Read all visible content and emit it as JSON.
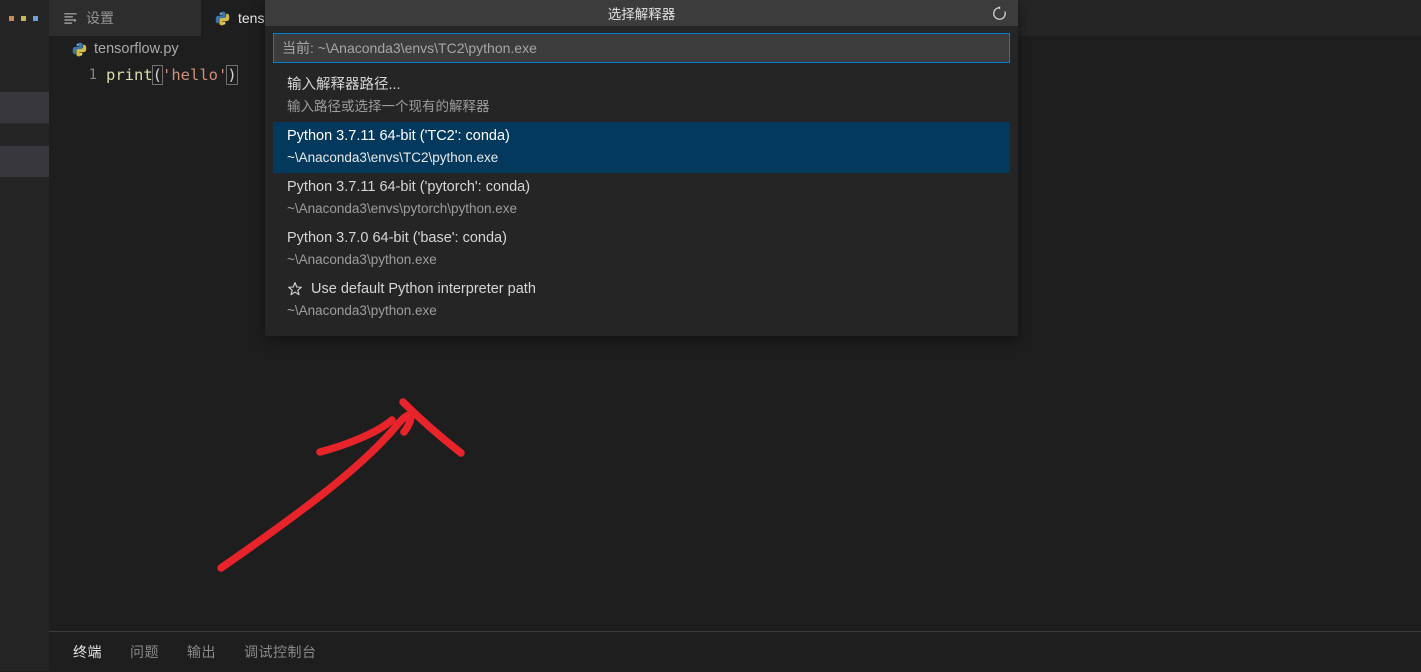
{
  "colors": {
    "editor_bg": "#1e1e1e",
    "chrome_bg": "#252526",
    "titlebar_bg": "#3c3c3c",
    "accent_blue": "#007fd4",
    "selection_blue": "#04395e",
    "annotation_red": "#e8232a"
  },
  "activity_strip": {
    "more_actions_icon": "more-actions-icon"
  },
  "tabs": [
    {
      "label": "设置",
      "icon": "settings-lines-icon",
      "active": false
    },
    {
      "label": "tens",
      "icon": "python-file-icon",
      "active": true
    }
  ],
  "editor": {
    "breadcrumb": {
      "icon": "python-file-icon",
      "label": "tensorflow.py"
    },
    "code": {
      "line_number": "1",
      "tokens": {
        "fn": "print",
        "open_paren": "(",
        "string": "'hello'",
        "close_paren": ")"
      }
    }
  },
  "quickpick": {
    "title": "选择解释器",
    "refresh_icon": "refresh-icon",
    "input": {
      "value": "",
      "placeholder": "当前: ~\\Anaconda3\\envs\\TC2\\python.exe"
    },
    "items": [
      {
        "label": "输入解释器路径...",
        "description": "输入路径或选择一个现有的解释器",
        "icon": "",
        "selected": false
      },
      {
        "label": "Python 3.7.11 64-bit ('TC2': conda)",
        "description": "~\\Anaconda3\\envs\\TC2\\python.exe",
        "icon": "",
        "selected": true
      },
      {
        "label": "Python 3.7.11 64-bit ('pytorch': conda)",
        "description": "~\\Anaconda3\\envs\\pytorch\\python.exe",
        "icon": "",
        "selected": false
      },
      {
        "label": "Python 3.7.0 64-bit ('base': conda)",
        "description": "~\\Anaconda3\\python.exe",
        "icon": "",
        "selected": false
      },
      {
        "label": "Use default Python interpreter path",
        "description": "~\\Anaconda3\\python.exe",
        "icon": "star-icon",
        "selected": false
      }
    ]
  },
  "panel": {
    "tabs": [
      {
        "label": "终端",
        "active": true
      },
      {
        "label": "问题",
        "active": false
      },
      {
        "label": "输出",
        "active": false
      },
      {
        "label": "调试控制台",
        "active": false
      }
    ]
  }
}
